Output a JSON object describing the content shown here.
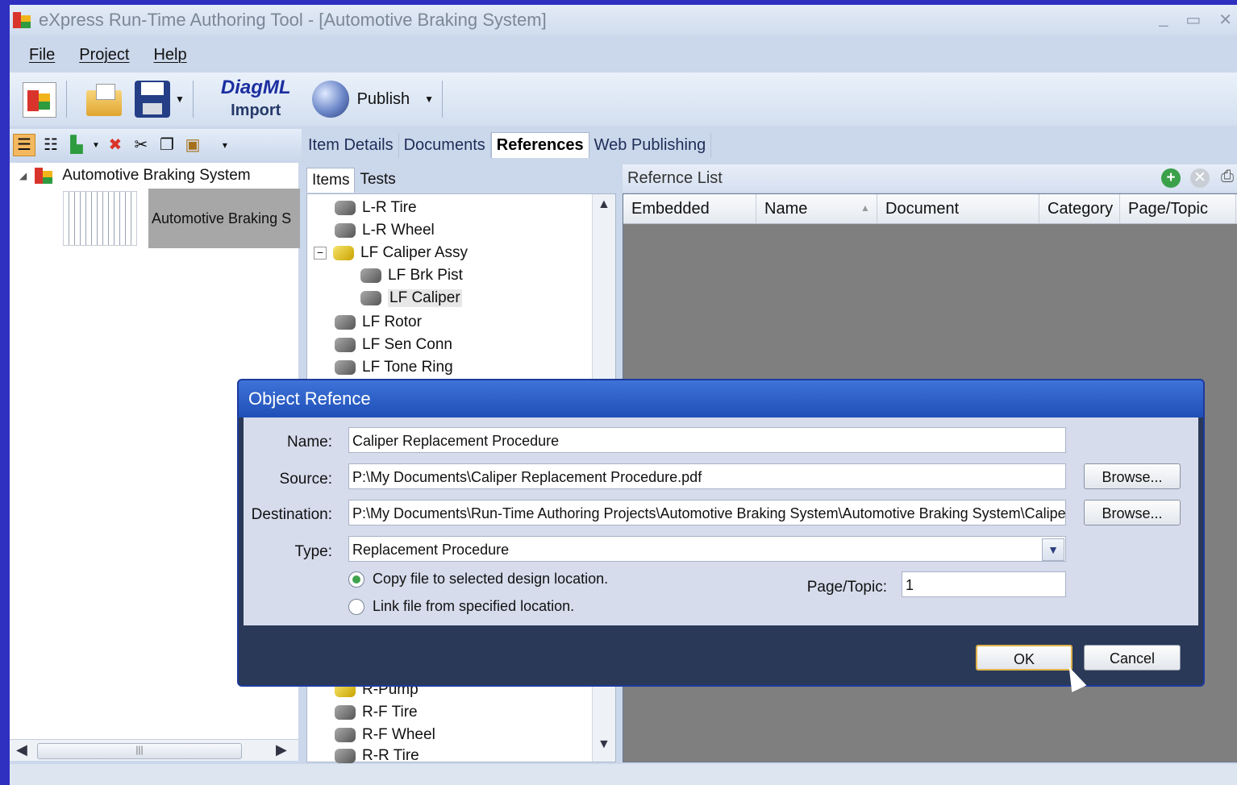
{
  "window": {
    "title": "eXpress Run-Time Authoring Tool - [Automotive Braking System]",
    "min": "_",
    "max": "▭",
    "close": "✕"
  },
  "menu": [
    "File",
    "Project",
    "Help"
  ],
  "toolbar": {
    "diagml_line1": "DiagML",
    "diagml_line2": "Import",
    "publish": "Publish"
  },
  "project_tree": {
    "root": "Automotive Braking System",
    "thumb_label": "Automotive Braking S"
  },
  "main_tabs": [
    "Item Details",
    "Documents",
    "References",
    "Web Publishing"
  ],
  "active_main_tab": "References",
  "sub_tabs": [
    "Items",
    "Tests"
  ],
  "items": [
    "L-R Tire",
    "L-R Wheel",
    "LF Caliper Assy",
    "LF Brk Pist",
    "LF Caliper",
    "LF Rotor",
    "LF Sen Conn",
    "LF Tone Ring",
    "R-Pump",
    "R-F Tire",
    "R-F Wheel",
    "R-R Tire"
  ],
  "selected_item": "LF Caliper",
  "reference_list": {
    "title": "Refernce List",
    "columns": [
      "Embedded",
      "Name",
      "Document",
      "Category",
      "Page/Topic"
    ]
  },
  "dialog": {
    "title": "Object Refence",
    "name_label": "Name:",
    "name_value": "Caliper Replacement Procedure",
    "source_label": "Source:",
    "source_value": "P:\\My Documents\\Caliper Replacement Procedure.pdf",
    "destination_label": "Destination:",
    "destination_value": "P:\\My Documents\\Run-Time Authoring Projects\\Automotive Braking System\\Automotive Braking System\\Calipe",
    "type_label": "Type:",
    "type_value": "Replacement Procedure",
    "browse": "Browse...",
    "radio_copy": "Copy file to selected design location.",
    "radio_link": "Link file from specified location.",
    "page_label": "Page/Topic:",
    "page_value": "1",
    "ok": "OK",
    "cancel": "Cancel"
  }
}
